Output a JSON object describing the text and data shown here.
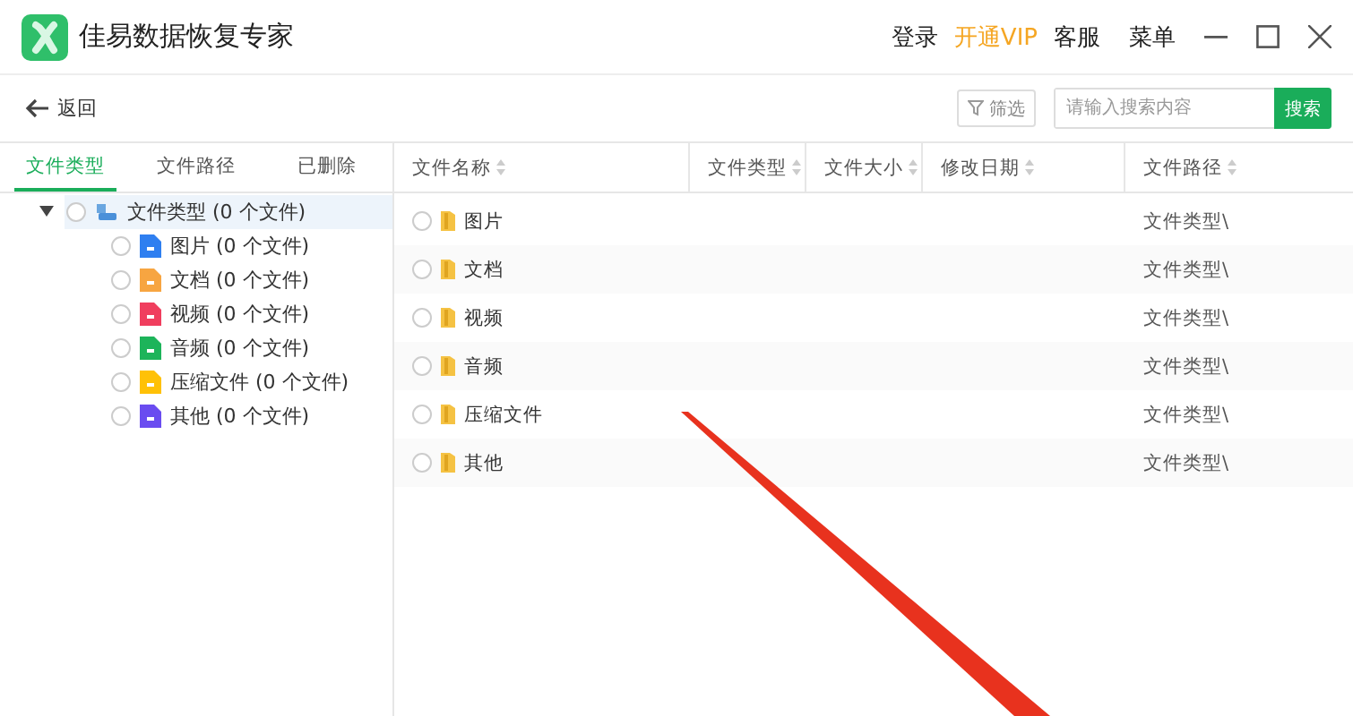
{
  "window": {
    "title": "佳易数据恢复专家"
  },
  "header_links": [
    {
      "label": "登录",
      "kind": "plain"
    },
    {
      "label": "开通VIP",
      "kind": "highlight"
    },
    {
      "label": "客服",
      "kind": "plain"
    },
    {
      "label": "菜单",
      "kind": "plain"
    }
  ],
  "toolbar": {
    "back": "返回",
    "filter": "筛选",
    "search": {
      "placeholder": "请输入搜索内容",
      "button": "搜索"
    }
  },
  "tabs": [
    {
      "label": "文件类型",
      "selected": true
    },
    {
      "label": "文件路径",
      "selected": false
    },
    {
      "label": "已删除",
      "selected": false
    }
  ],
  "tree": {
    "label": "文件类型 (0 个文件)",
    "expanded": true,
    "checked": false,
    "selected": true,
    "children": [
      {
        "label": "图片 (0 个文件)",
        "color": "#2f7ff0",
        "checked": false
      },
      {
        "label": "文档 (0 个文件)",
        "color": "#f7a541",
        "checked": false
      },
      {
        "label": "视频 (0 个文件)",
        "color": "#f03e5e",
        "checked": false
      },
      {
        "label": "音频 (0 个文件)",
        "color": "#1db45a",
        "checked": false
      },
      {
        "label": "压缩文件 (0 个文件)",
        "color": "#ffc107",
        "checked": false
      },
      {
        "label": "其他 (0 个文件)",
        "color": "#6a4cf0",
        "checked": false
      }
    ]
  },
  "table": {
    "columns": [
      "文件名称",
      "文件类型",
      "文件大小",
      "修改日期",
      "文件路径"
    ],
    "rows": [
      {
        "name": "图片",
        "path": "文件类型\\",
        "checked": false
      },
      {
        "name": "文档",
        "path": "文件类型\\",
        "checked": false
      },
      {
        "name": "视频",
        "path": "文件类型\\",
        "checked": false
      },
      {
        "name": "音频",
        "path": "文件类型\\",
        "checked": false
      },
      {
        "name": "压缩文件",
        "path": "文件类型\\",
        "checked": false
      },
      {
        "name": "其他",
        "path": "文件类型\\",
        "checked": false
      }
    ]
  }
}
